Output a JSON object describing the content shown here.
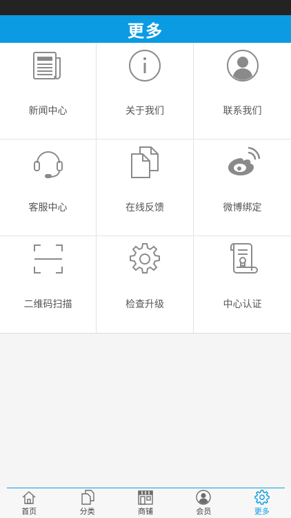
{
  "header": {
    "title": "更多"
  },
  "grid": {
    "items": [
      {
        "label": "新闻中心",
        "icon": "newspaper-icon"
      },
      {
        "label": "关于我们",
        "icon": "info-icon"
      },
      {
        "label": "联系我们",
        "icon": "contact-person-icon"
      },
      {
        "label": "客服中心",
        "icon": "headset-icon"
      },
      {
        "label": "在线反馈",
        "icon": "documents-icon"
      },
      {
        "label": "微博绑定",
        "icon": "weibo-icon"
      },
      {
        "label": "二维码扫描",
        "icon": "scan-frame-icon"
      },
      {
        "label": "检查升级",
        "icon": "gear-icon"
      },
      {
        "label": "中心认证",
        "icon": "certificate-scroll-icon"
      }
    ]
  },
  "tabbar": {
    "items": [
      {
        "label": "首页",
        "icon": "home-icon"
      },
      {
        "label": "分类",
        "icon": "category-icon"
      },
      {
        "label": "商铺",
        "icon": "store-icon"
      },
      {
        "label": "会员",
        "icon": "member-icon"
      },
      {
        "label": "更多",
        "icon": "gear-icon",
        "active": true
      }
    ]
  },
  "colors": {
    "accent": "#0a9be3",
    "status_bar": "#232323",
    "icon_gray": "#8a8a8a",
    "text": "#555555"
  }
}
